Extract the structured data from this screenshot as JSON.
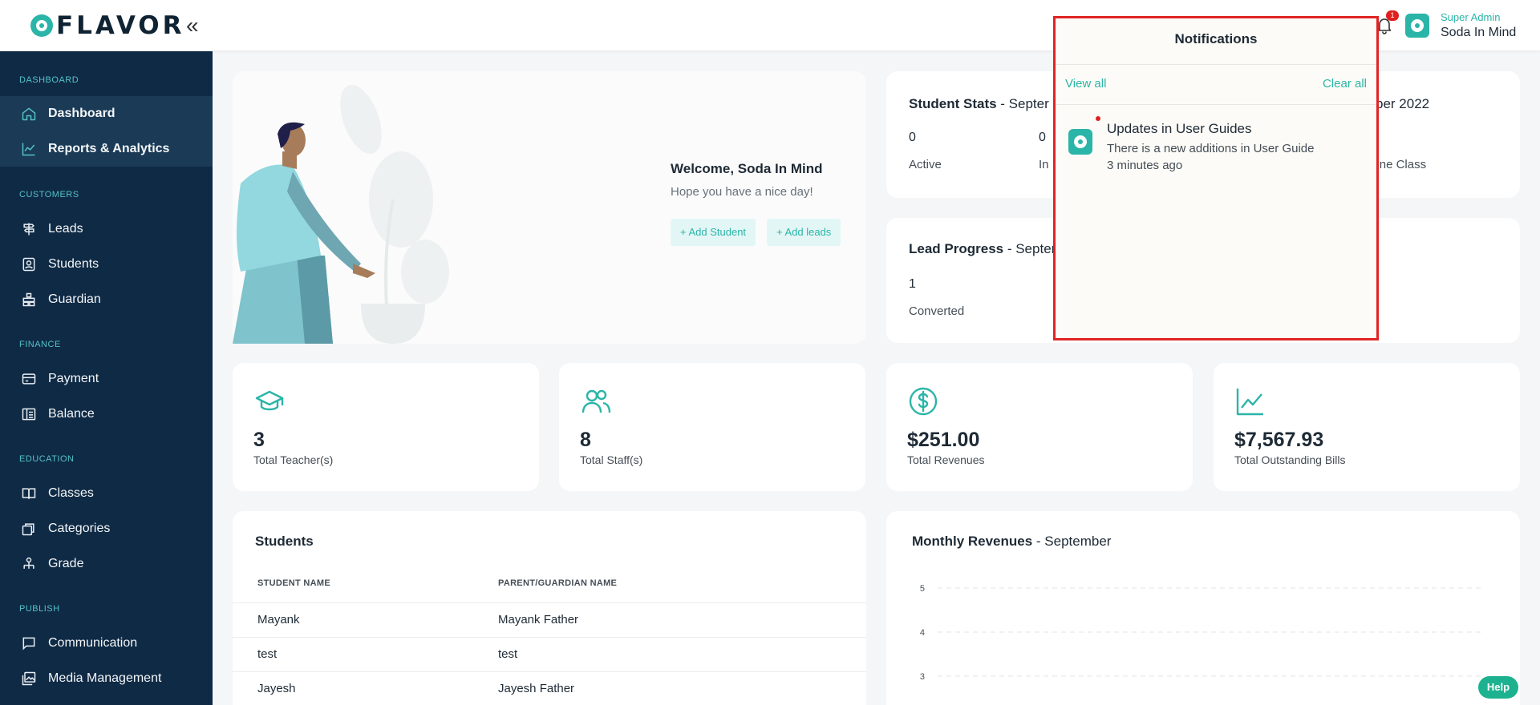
{
  "header": {
    "logo_text": "FLAVOR",
    "collapse_icon": "«",
    "notification_count": "1",
    "user_role": "Super Admin",
    "user_name": "Soda In Mind"
  },
  "sidebar": {
    "sections": {
      "dashboard": "DASHBOARD",
      "customers": "CUSTOMERS",
      "finance": "FINANCE",
      "education": "EDUCATION",
      "publish": "PUBLISH"
    },
    "items": {
      "dashboard": "Dashboard",
      "reports": "Reports & Analytics",
      "leads": "Leads",
      "students": "Students",
      "guardian": "Guardian",
      "payment": "Payment",
      "balance": "Balance",
      "classes": "Classes",
      "categories": "Categories",
      "grade": "Grade",
      "communication": "Communication",
      "media": "Media Management"
    }
  },
  "welcome": {
    "title": "Welcome, Soda In Mind",
    "subtitle": "Hope you have a nice day!",
    "add_student": "+ Add Student",
    "add_leads": "+ Add leads"
  },
  "student_stats": {
    "title": "Student Stats",
    "period_partial": " - Septer",
    "period_right": "ber 2022",
    "stats": [
      {
        "value": "0",
        "label": "Active"
      },
      {
        "value": "0",
        "label": "In"
      }
    ],
    "right_label": "ffline Class"
  },
  "lead_progress": {
    "title": "Lead Progress",
    "period_partial": " - Septer",
    "value": "1",
    "label": "Converted"
  },
  "metrics": [
    {
      "value": "3",
      "label": "Total Teacher(s)",
      "icon": "graduation-cap-icon"
    },
    {
      "value": "8",
      "label": "Total Staff(s)",
      "icon": "users-icon"
    },
    {
      "value": "$251.00",
      "label": "Total Revenues",
      "icon": "dollar-circle-icon"
    },
    {
      "value": "$7,567.93",
      "label": "Total Outstanding Bills",
      "icon": "trend-chart-icon"
    }
  ],
  "students": {
    "title": "Students",
    "columns": [
      "STUDENT NAME",
      "PARENT/GUARDIAN NAME"
    ],
    "rows": [
      [
        "Mayank",
        "Mayank Father"
      ],
      [
        "test",
        "test"
      ],
      [
        "Jayesh",
        "Jayesh Father"
      ]
    ]
  },
  "monthly_revenues": {
    "title": "Monthly Revenues",
    "period": " - September",
    "y_ticks": [
      "5",
      "4",
      "3"
    ]
  },
  "help_label": "Help",
  "notifications": {
    "title": "Notifications",
    "view_all": "View all",
    "clear_all": "Clear all",
    "items": [
      {
        "title": "Updates in User Guides",
        "body": "There is a new additions in User Guide",
        "time": "3 minutes ago"
      }
    ]
  },
  "colors": {
    "accent": "#2bb5a8",
    "sidebar_bg": "#0f2a45",
    "alert_red": "#e02424",
    "help_green": "#1db28f"
  }
}
